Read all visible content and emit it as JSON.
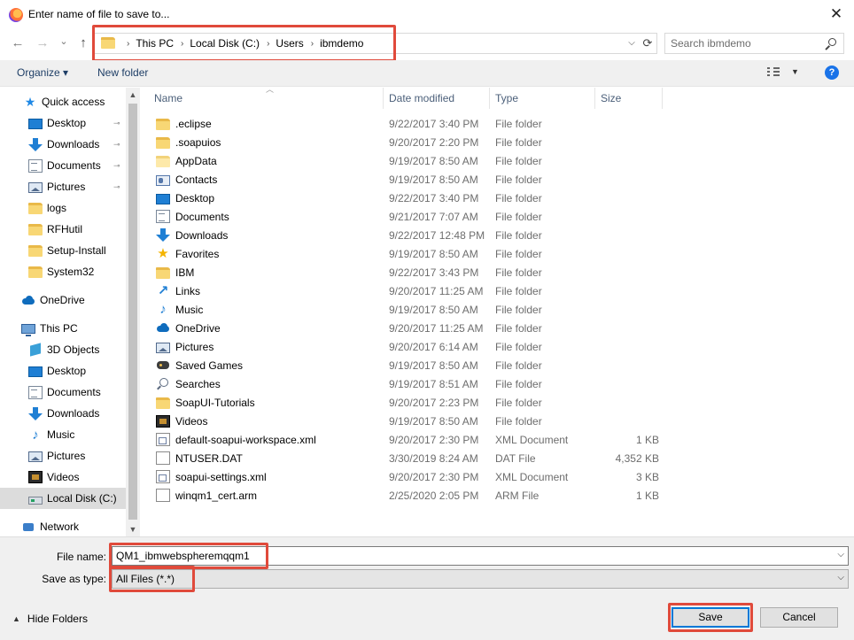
{
  "window": {
    "title": "Enter name of file to save to...",
    "close_glyph": "✕"
  },
  "nav": {
    "back_glyph": "←",
    "forward_glyph": "→",
    "recent_glyph": "⌄",
    "up_glyph": "↑",
    "breadcrumb": [
      "This PC",
      "Local Disk (C:)",
      "Users",
      "ibmdemo"
    ],
    "separator": "›",
    "search_placeholder": "Search ibmdemo"
  },
  "toolbar": {
    "organize_label": "Organize ▾",
    "new_folder_label": "New folder",
    "help_glyph": "?"
  },
  "sidebar": {
    "items": [
      {
        "label": "Quick access",
        "icon": "star-icon",
        "pinned": false
      },
      {
        "label": "Desktop",
        "icon": "desktop-icon",
        "pinned": true
      },
      {
        "label": "Downloads",
        "icon": "downloads-icon",
        "pinned": true
      },
      {
        "label": "Documents",
        "icon": "documents-icon",
        "pinned": true
      },
      {
        "label": "Pictures",
        "icon": "pictures-icon",
        "pinned": true
      },
      {
        "label": "logs",
        "icon": "folder-icon",
        "pinned": false
      },
      {
        "label": "RFHutil",
        "icon": "folder-icon",
        "pinned": false
      },
      {
        "label": "Setup-Install",
        "icon": "folder-icon",
        "pinned": false
      },
      {
        "label": "System32",
        "icon": "folder-icon",
        "pinned": false
      },
      {
        "label": "OneDrive",
        "icon": "onedrive-icon",
        "pinned": false
      },
      {
        "label": "This PC",
        "icon": "pc-icon",
        "pinned": false
      },
      {
        "label": "3D Objects",
        "icon": "3d-objects-icon",
        "pinned": false
      },
      {
        "label": "Desktop",
        "icon": "desktop-icon",
        "pinned": false
      },
      {
        "label": "Documents",
        "icon": "documents-icon",
        "pinned": false
      },
      {
        "label": "Downloads",
        "icon": "downloads-icon",
        "pinned": false
      },
      {
        "label": "Music",
        "icon": "music-icon",
        "pinned": false
      },
      {
        "label": "Pictures",
        "icon": "pictures-icon",
        "pinned": false
      },
      {
        "label": "Videos",
        "icon": "videos-icon",
        "pinned": false
      },
      {
        "label": "Local Disk (C:)",
        "icon": "disk-icon",
        "pinned": false,
        "selected": true
      },
      {
        "label": "Network",
        "icon": "network-icon",
        "pinned": false
      }
    ],
    "pin_glyph": "📌"
  },
  "columns": {
    "name": "Name",
    "date": "Date modified",
    "type": "Type",
    "size": "Size"
  },
  "files": [
    {
      "name": ".eclipse",
      "date": "9/22/2017 3:40 PM",
      "type": "File folder",
      "size": "",
      "icon": "folder-icon"
    },
    {
      "name": ".soapuios",
      "date": "9/20/2017 2:20 PM",
      "type": "File folder",
      "size": "",
      "icon": "folder-icon"
    },
    {
      "name": "AppData",
      "date": "9/19/2017 8:50 AM",
      "type": "File folder",
      "size": "",
      "icon": "folder-pale-icon"
    },
    {
      "name": "Contacts",
      "date": "9/19/2017 8:50 AM",
      "type": "File folder",
      "size": "",
      "icon": "contacts-icon"
    },
    {
      "name": "Desktop",
      "date": "9/22/2017 3:40 PM",
      "type": "File folder",
      "size": "",
      "icon": "desktop-icon"
    },
    {
      "name": "Documents",
      "date": "9/21/2017 7:07 AM",
      "type": "File folder",
      "size": "",
      "icon": "documents-icon"
    },
    {
      "name": "Downloads",
      "date": "9/22/2017 12:48 PM",
      "type": "File folder",
      "size": "",
      "icon": "downloads-icon"
    },
    {
      "name": "Favorites",
      "date": "9/19/2017 8:50 AM",
      "type": "File folder",
      "size": "",
      "icon": "favorites-icon"
    },
    {
      "name": "IBM",
      "date": "9/22/2017 3:43 PM",
      "type": "File folder",
      "size": "",
      "icon": "folder-icon"
    },
    {
      "name": "Links",
      "date": "9/20/2017 11:25 AM",
      "type": "File folder",
      "size": "",
      "icon": "links-icon"
    },
    {
      "name": "Music",
      "date": "9/19/2017 8:50 AM",
      "type": "File folder",
      "size": "",
      "icon": "music-icon"
    },
    {
      "name": "OneDrive",
      "date": "9/20/2017 11:25 AM",
      "type": "File folder",
      "size": "",
      "icon": "onedrive-icon"
    },
    {
      "name": "Pictures",
      "date": "9/20/2017 6:14 AM",
      "type": "File folder",
      "size": "",
      "icon": "pictures-icon"
    },
    {
      "name": "Saved Games",
      "date": "9/19/2017 8:50 AM",
      "type": "File folder",
      "size": "",
      "icon": "saved-games-icon"
    },
    {
      "name": "Searches",
      "date": "9/19/2017 8:51 AM",
      "type": "File folder",
      "size": "",
      "icon": "searches-icon"
    },
    {
      "name": "SoapUI-Tutorials",
      "date": "9/20/2017 2:23 PM",
      "type": "File folder",
      "size": "",
      "icon": "folder-icon"
    },
    {
      "name": "Videos",
      "date": "9/19/2017 8:50 AM",
      "type": "File folder",
      "size": "",
      "icon": "videos-icon"
    },
    {
      "name": "default-soapui-workspace.xml",
      "date": "9/20/2017 2:30 PM",
      "type": "XML Document",
      "size": "1 KB",
      "icon": "xml-file-icon"
    },
    {
      "name": "NTUSER.DAT",
      "date": "3/30/2019 8:24 AM",
      "type": "DAT File",
      "size": "4,352 KB",
      "icon": "file-icon"
    },
    {
      "name": "soapui-settings.xml",
      "date": "9/20/2017 2:30 PM",
      "type": "XML Document",
      "size": "3 KB",
      "icon": "xml-file-icon"
    },
    {
      "name": "winqm1_cert.arm",
      "date": "2/25/2020 2:05 PM",
      "type": "ARM File",
      "size": "1 KB",
      "icon": "file-icon"
    }
  ],
  "form": {
    "file_name_label": "File name:",
    "file_name_value": "QM1_ibmwebspheremqqm1",
    "save_type_label": "Save as type:",
    "save_type_value": "All Files (*.*)"
  },
  "footer": {
    "hide_folders_label": "Hide Folders",
    "save_label": "Save",
    "cancel_label": "Cancel"
  },
  "colors": {
    "highlight": "#e04a3b",
    "accent": "#0078d7",
    "secondary_text": "#6d6d6d"
  }
}
